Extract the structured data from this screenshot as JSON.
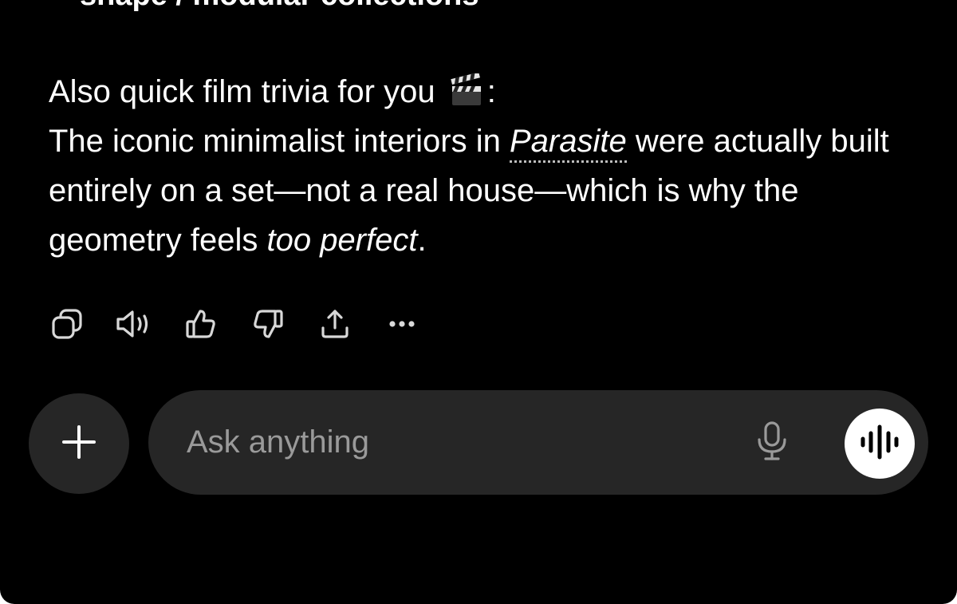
{
  "previous_message": {
    "cut_line": "shape / modular collections"
  },
  "message": {
    "line1_text": "Also quick film trivia for you ",
    "line1_emoji_icon": "clapper-board-icon",
    "line1_suffix": ":",
    "para_start": "The iconic minimalist interiors in ",
    "link_term": "Parasite",
    "para_middle": " were actually built entirely on a set—not a real house—which is why the geometry feels ",
    "para_emphasis": "too perfect",
    "para_end": "."
  },
  "actions": {
    "copy_icon": "copy-icon",
    "read_aloud_icon": "speaker-icon",
    "thumbs_up_icon": "thumbs-up-icon",
    "thumbs_down_icon": "thumbs-down-icon",
    "share_icon": "share-icon",
    "more_icon": "more-icon"
  },
  "composer": {
    "placeholder": "Ask anything",
    "value": "",
    "plus_icon": "plus-icon",
    "mic_icon": "microphone-icon",
    "voice_icon": "voice-waveform-icon"
  },
  "colors": {
    "background": "#000000",
    "text": "#ffffff",
    "surface": "#262626",
    "placeholder": "#9a9a9a",
    "icon": "#d8d8d8"
  }
}
